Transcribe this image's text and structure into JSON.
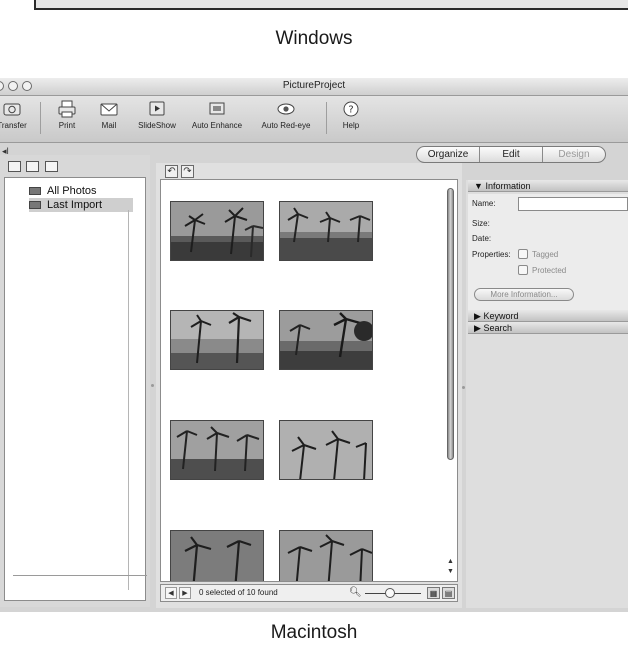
{
  "captions": {
    "windows": "Windows",
    "macintosh": "Macintosh"
  },
  "window": {
    "title": "PictureProject"
  },
  "toolbar": {
    "items": [
      {
        "label": "Transfer",
        "icon": "transfer-icon"
      },
      {
        "label": "Print",
        "icon": "print-icon"
      },
      {
        "label": "Mail",
        "icon": "mail-icon"
      },
      {
        "label": "SlideShow",
        "icon": "slideshow-icon"
      },
      {
        "label": "Auto Enhance",
        "icon": "auto-enhance-icon"
      },
      {
        "label": "Auto Red-eye",
        "icon": "red-eye-icon"
      },
      {
        "label": "Help",
        "icon": "help-icon"
      }
    ]
  },
  "modes": {
    "items": [
      "Organize",
      "Edit",
      "Design"
    ],
    "disabled": "Design"
  },
  "collections": {
    "items": [
      {
        "label": "All Photos"
      },
      {
        "label": "Last Import",
        "selected": true
      }
    ]
  },
  "status": {
    "text": "0 selected of 10 found"
  },
  "info_panel": {
    "header": "Information",
    "name_label": "Name:",
    "size_label": "Size:",
    "date_label": "Date:",
    "properties_label": "Properties:",
    "tagged_label": "Tagged",
    "protected_label": "Protected",
    "more_button": "More Information..."
  },
  "keyword_section": {
    "header": "Keyword"
  },
  "search_section": {
    "header": "Search"
  },
  "colors": {
    "window_bg": "#d4d4d4",
    "panel_header": "#c8c8c8",
    "grid_bg": "#ffffff"
  }
}
